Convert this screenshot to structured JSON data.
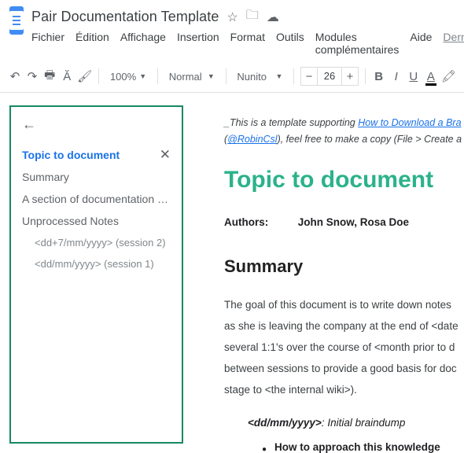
{
  "header": {
    "doc_title": "Pair Documentation Template",
    "menus": [
      "Fichier",
      "Édition",
      "Affichage",
      "Insertion",
      "Format",
      "Outils",
      "Modules complémentaires",
      "Aide"
    ],
    "last_edit": "Derniè"
  },
  "toolbar": {
    "zoom": "100%",
    "style": "Normal",
    "font": "Nunito",
    "font_size": "26"
  },
  "outline": {
    "active": "Topic to document",
    "items": [
      "Summary",
      "A section of documentation dr…",
      "Unprocessed Notes"
    ],
    "subitems": [
      "<dd+7/mm/yyyy> (session 2)",
      "<dd/mm/yyyy> (session 1)"
    ]
  },
  "doc": {
    "intro_prefix": "_This is a template supporting ",
    "intro_link": "How to Download a Bra",
    "intro_line2_open": "(",
    "intro_handle": "@RobinCsl",
    "intro_line2_rest": "), feel free to make a copy (File > Create a",
    "h1": "Topic to document",
    "authors_label": "Authors:",
    "authors_names": "John Snow, Rosa Doe",
    "h2": "Summary",
    "para": "The goal of this document is to write down notes as she is leaving the company at the end of <date several 1:1's over the course of <month prior to d between sessions to provide a good basis for doc stage to <the internal wiki>).",
    "stage_label": "<dd/mm/yyyy>",
    "stage_desc": ": Initial braindump",
    "bullet1": "How to approach this knowledge"
  }
}
